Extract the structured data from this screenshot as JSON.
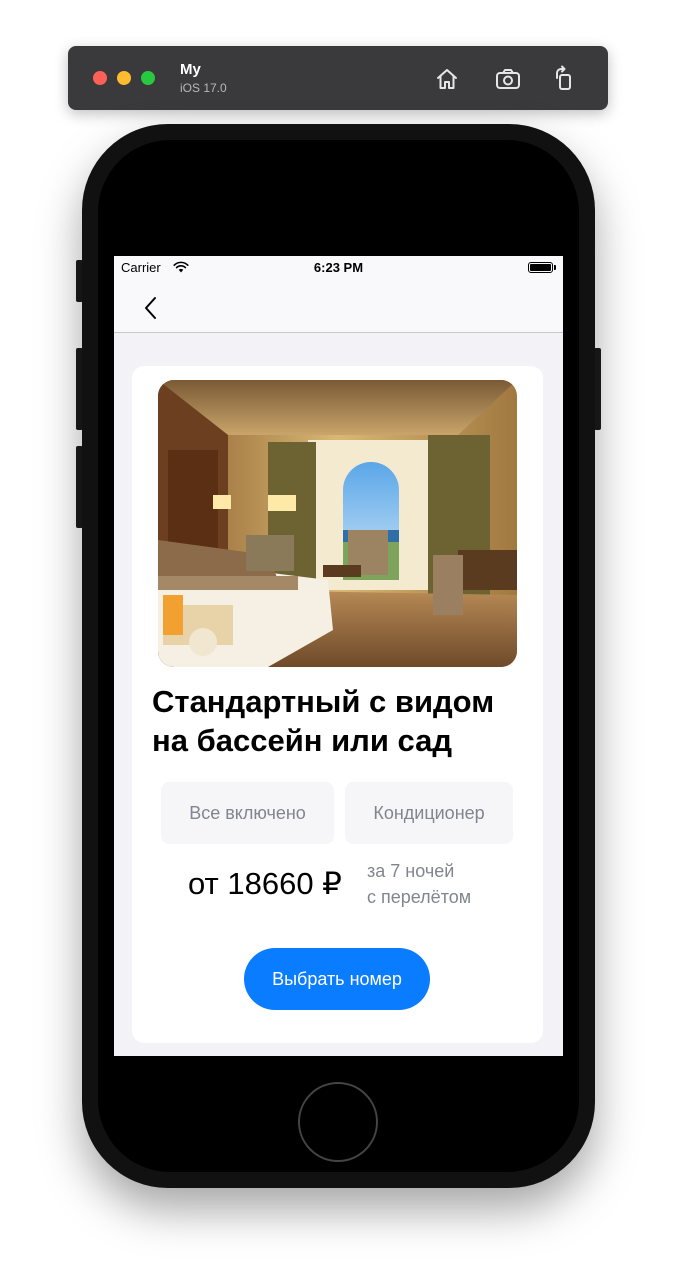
{
  "simulator": {
    "title": "My",
    "subtitle": "iOS 17.0",
    "toolbar_icons": [
      "home-icon",
      "screenshot-icon",
      "rotate-icon"
    ]
  },
  "status_bar": {
    "carrier": "Carrier",
    "time": "6:23 PM",
    "icons": [
      "wifi-icon",
      "battery-icon"
    ]
  },
  "navbar": {
    "back_icon": "chevron-left-icon"
  },
  "room": {
    "image": "hotel-room-photo",
    "title_line1": "Стандартный с видом",
    "title_line2": "на бассейн или сад",
    "tags": [
      "Все включено",
      "Кондиционер"
    ],
    "price": "от 18660 ₽",
    "price_note_line1": "за 7 ночей",
    "price_note_line2": "с перелётом",
    "select_button": "Выбрать номер"
  },
  "colors": {
    "accent": "#0a7cff",
    "background": "#f2f2f7",
    "card": "#ffffff",
    "tag_background": "#f6f6f9",
    "secondary_text": "#82858e",
    "toolbar": "#3a3a3c"
  }
}
